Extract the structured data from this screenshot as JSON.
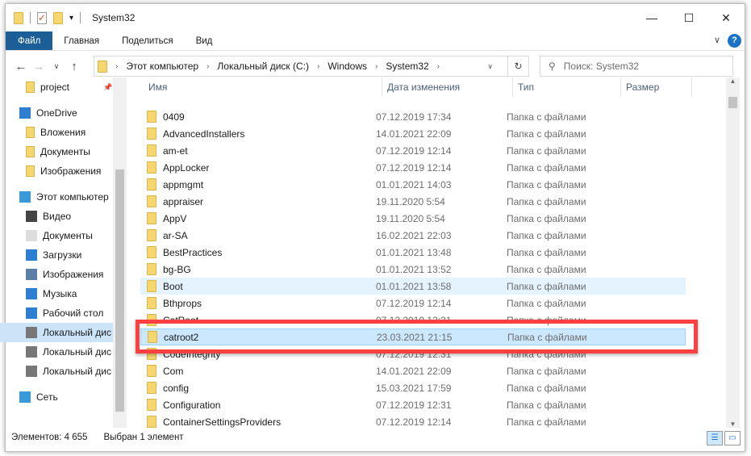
{
  "title": "System32",
  "ribbon": {
    "tabs": [
      "Файл",
      "Главная",
      "Поделиться",
      "Вид"
    ]
  },
  "address": {
    "crumbs": [
      "Этот компьютер",
      "Локальный диск (C:)",
      "Windows",
      "System32"
    ]
  },
  "search": {
    "placeholder": "Поиск: System32"
  },
  "sidebar": [
    {
      "label": "project",
      "icon": "folder-icon"
    },
    {
      "label": "OneDrive",
      "icon": "cloud-icon"
    },
    {
      "label": "Вложения",
      "icon": "folder-icon"
    },
    {
      "label": "Документы",
      "icon": "folder-icon"
    },
    {
      "label": "Изображения",
      "icon": "folder-icon"
    },
    {
      "label": "Этот компьютер",
      "icon": "computer-icon"
    },
    {
      "label": "Видео",
      "icon": "video-icon"
    },
    {
      "label": "Документы",
      "icon": "documents-icon"
    },
    {
      "label": "Загрузки",
      "icon": "download-icon"
    },
    {
      "label": "Изображения",
      "icon": "pictures-icon"
    },
    {
      "label": "Музыка",
      "icon": "music-icon"
    },
    {
      "label": "Рабочий стол",
      "icon": "desktop-icon"
    },
    {
      "label": "Локальный дис",
      "icon": "drive-icon"
    },
    {
      "label": "Локальный дис",
      "icon": "drive-icon"
    },
    {
      "label": "Локальный дис",
      "icon": "drive-icon"
    },
    {
      "label": "Сеть",
      "icon": "network-icon"
    }
  ],
  "columns": [
    "Имя",
    "Дата изменения",
    "Тип",
    "Размер"
  ],
  "files": [
    {
      "name": "0409",
      "date": "07.12.2019 17:34",
      "type": "Папка с файлами"
    },
    {
      "name": "AdvancedInstallers",
      "date": "14.01.2021 22:09",
      "type": "Папка с файлами"
    },
    {
      "name": "am-et",
      "date": "07.12.2019 12:14",
      "type": "Папка с файлами"
    },
    {
      "name": "AppLocker",
      "date": "07.12.2019 12:14",
      "type": "Папка с файлами"
    },
    {
      "name": "appmgmt",
      "date": "01.01.2021 14:03",
      "type": "Папка с файлами"
    },
    {
      "name": "appraiser",
      "date": "19.11.2020 5:54",
      "type": "Папка с файлами"
    },
    {
      "name": "AppV",
      "date": "19.11.2020 5:54",
      "type": "Папка с файлами"
    },
    {
      "name": "ar-SA",
      "date": "16.02.2021 22:03",
      "type": "Папка с файлами"
    },
    {
      "name": "BestPractices",
      "date": "01.01.2021 13:48",
      "type": "Папка с файлами"
    },
    {
      "name": "bg-BG",
      "date": "01.01.2021 13:52",
      "type": "Папка с файлами"
    },
    {
      "name": "Boot",
      "date": "01.01.2021 13:58",
      "type": "Папка с файлами"
    },
    {
      "name": "Bthprops",
      "date": "07.12.2019 12:14",
      "type": "Папка с файлами"
    },
    {
      "name": "CatRoot",
      "date": "07.12.2019 12:31",
      "type": "Папка с файлами"
    },
    {
      "name": "catroot2",
      "date": "23.03.2021 21:15",
      "type": "Папка с файлами"
    },
    {
      "name": "CodeIntegrity",
      "date": "07.12.2019 12:31",
      "type": "Папка с файлами"
    },
    {
      "name": "Com",
      "date": "14.01.2021 22:09",
      "type": "Папка с файлами"
    },
    {
      "name": "config",
      "date": "15.03.2021 17:59",
      "type": "Папка с файлами"
    },
    {
      "name": "Configuration",
      "date": "07.12.2019 12:31",
      "type": "Папка с файлами"
    },
    {
      "name": "ContainerSettingsProviders",
      "date": "07.12.2019 12:14",
      "type": "Папка с файлами"
    }
  ],
  "status": {
    "count": "Элементов: 4 655",
    "selected": "Выбран 1 элемент"
  },
  "colors": {
    "accent": "#1c5f96",
    "highlight": "#ff4040",
    "selection": "#cce8ff"
  }
}
